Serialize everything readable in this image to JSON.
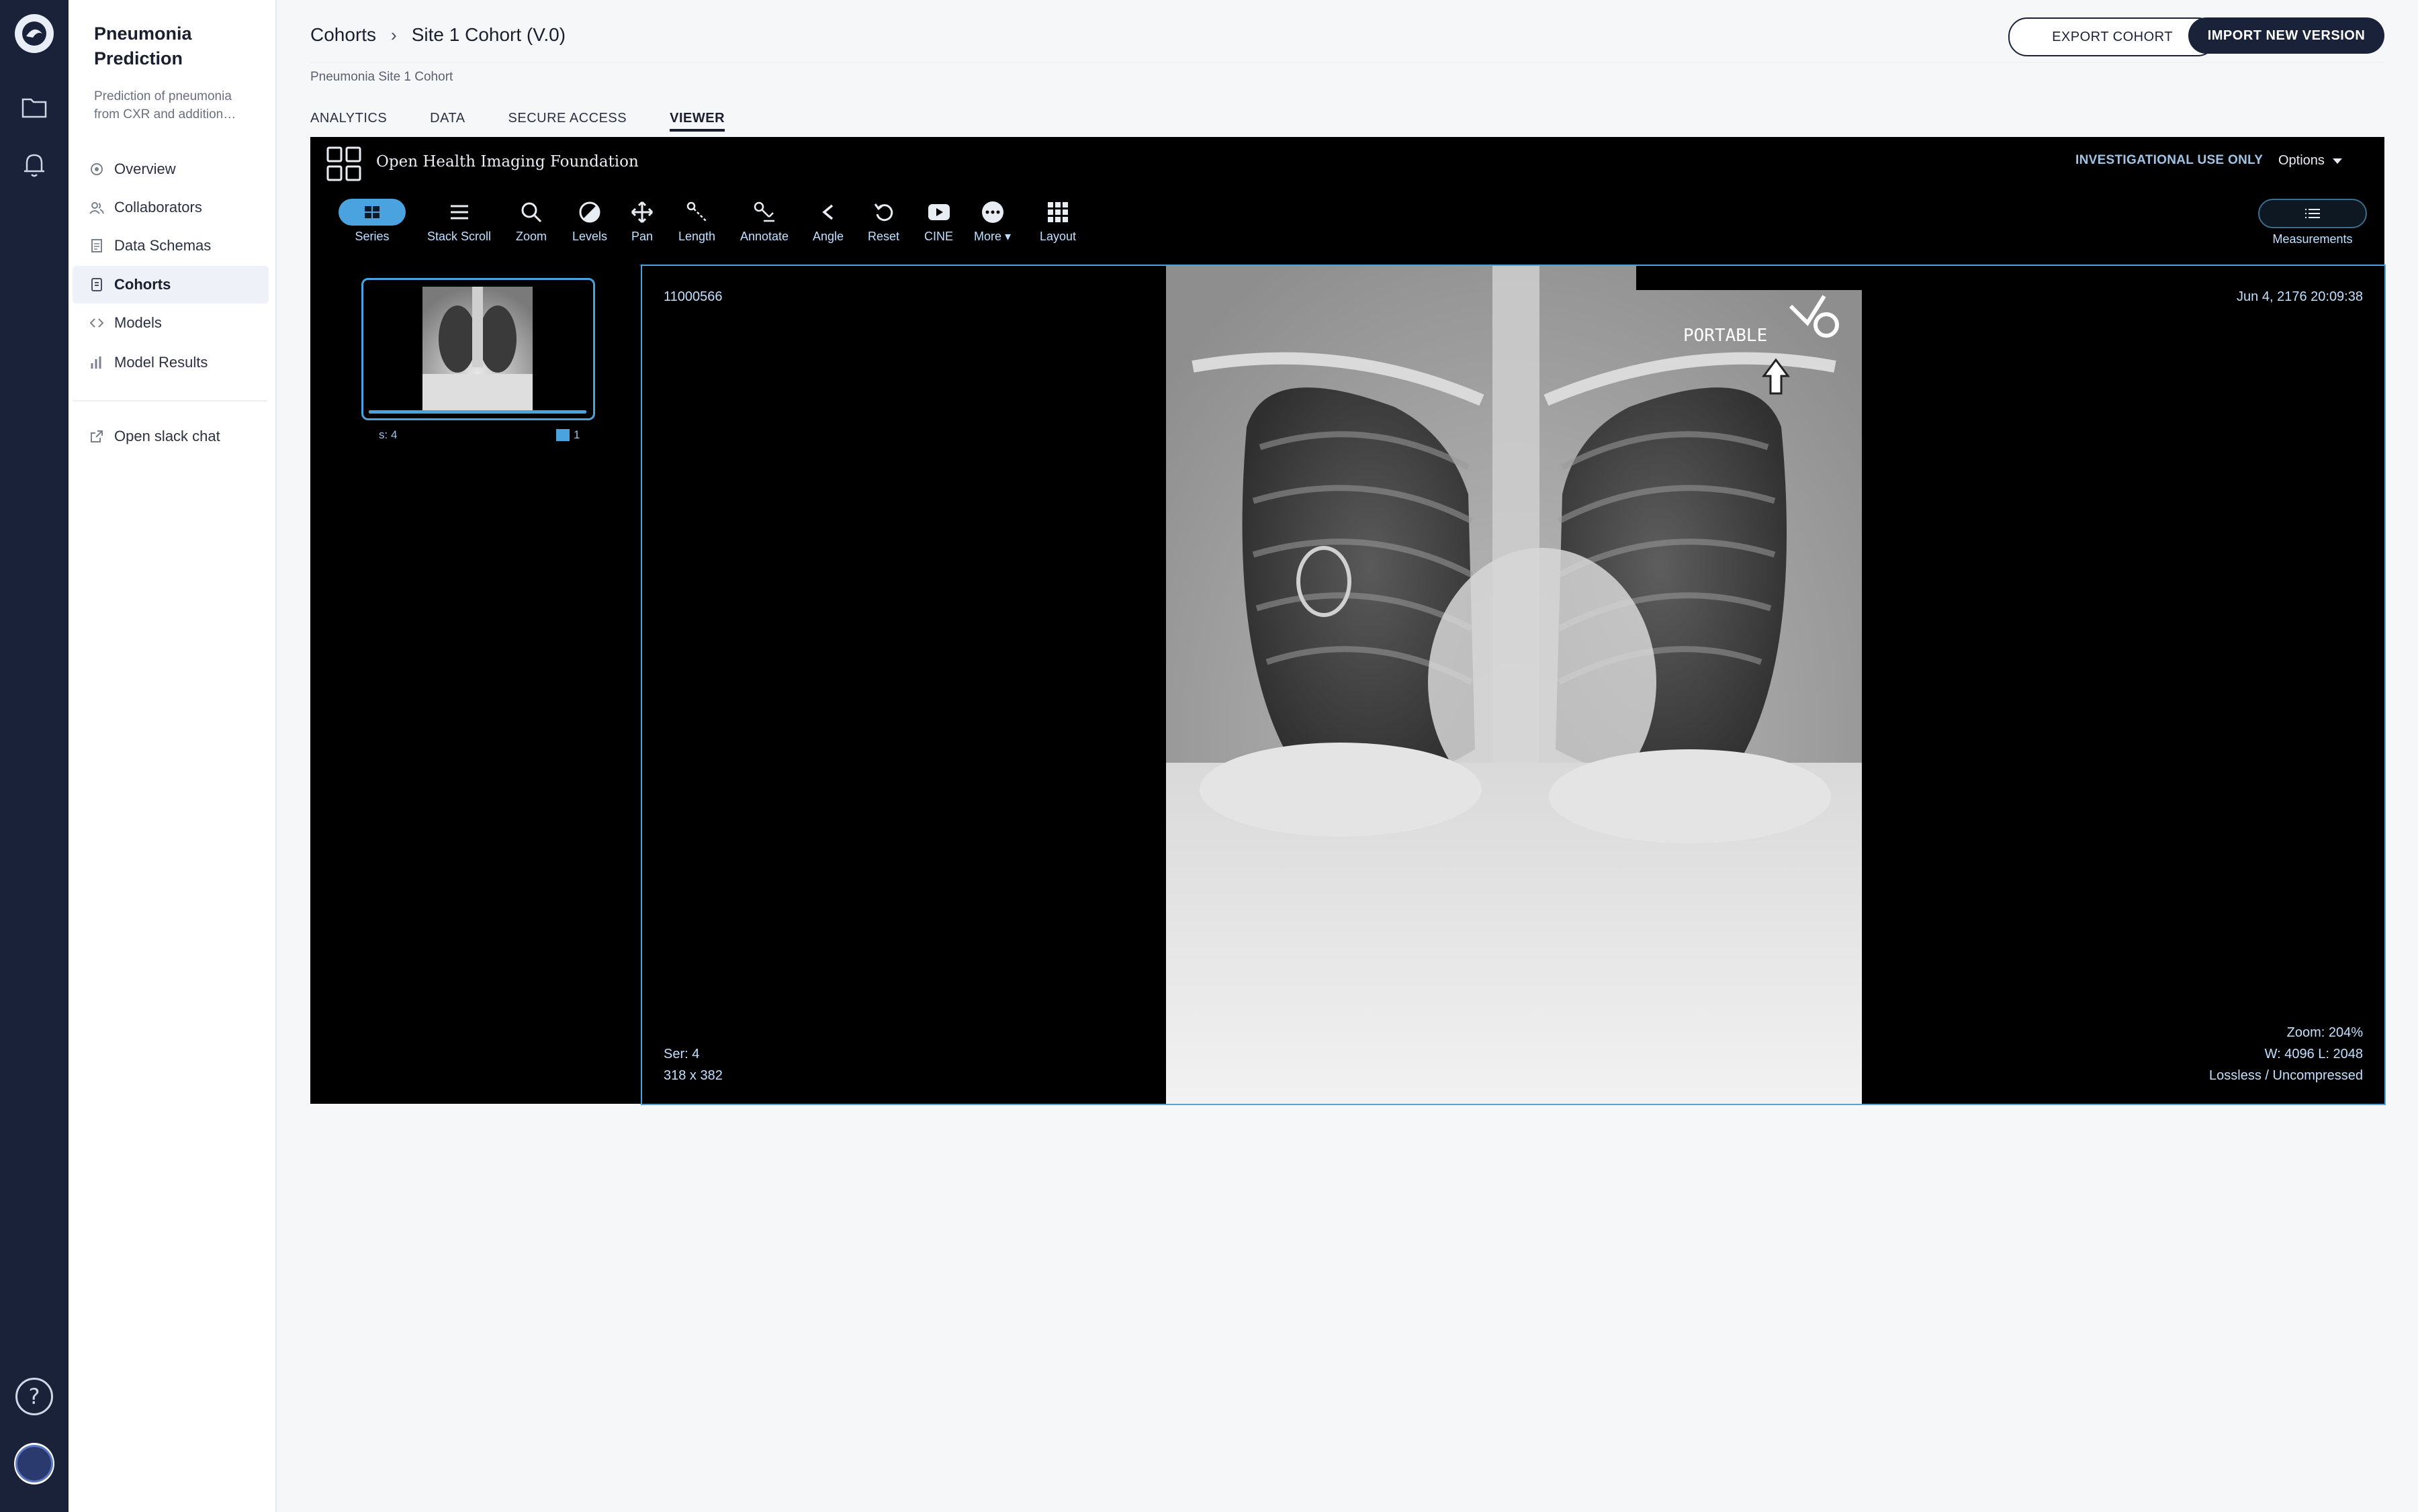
{
  "project": {
    "title": "Pneumonia Prediction",
    "description": "Prediction of pneumonia from CXR and addition…"
  },
  "nav": {
    "items": [
      {
        "label": "Overview",
        "icon": "overview-icon"
      },
      {
        "label": "Collaborators",
        "icon": "users-icon"
      },
      {
        "label": "Data Schemas",
        "icon": "schema-icon"
      },
      {
        "label": "Cohorts",
        "icon": "cohort-icon"
      },
      {
        "label": "Models",
        "icon": "code-icon"
      },
      {
        "label": "Model Results",
        "icon": "bar-chart-icon"
      }
    ],
    "slack": {
      "label": "Open slack chat",
      "icon": "external-link-icon"
    }
  },
  "header": {
    "breadcrumb": [
      "Cohorts",
      "Site 1 Cohort (V.0)"
    ],
    "export_label": "EXPORT COHORT",
    "import_label": "IMPORT NEW VERSION",
    "cohort_name": "Pneumonia Site 1 Cohort"
  },
  "tabs": [
    "ANALYTICS",
    "DATA",
    "SECURE ACCESS",
    "VIEWER"
  ],
  "viewer": {
    "app_name": "Open Health Imaging Foundation",
    "notice": "INVESTIGATIONAL USE ONLY",
    "options_label": "Options",
    "tools": [
      "Series",
      "Stack Scroll",
      "Zoom",
      "Levels",
      "Pan",
      "Length",
      "Annotate",
      "Angle",
      "Reset",
      "CINE",
      "More",
      "Layout"
    ],
    "measurements_label": "Measurements",
    "thumbnail": {
      "series": "s: 4",
      "count": "1"
    },
    "overlay": {
      "patient_id": "11000566",
      "datetime": "Jun 4, 2176 20:09:38",
      "series": "Ser: 4",
      "dimensions": "318 x 382",
      "zoom": "Zoom: 204%",
      "window_level": "W: 4096 L: 2048",
      "compression": "Lossless / Uncompressed"
    },
    "image_marker": "PORTABLE",
    "accent_color": "#4aa3df"
  }
}
